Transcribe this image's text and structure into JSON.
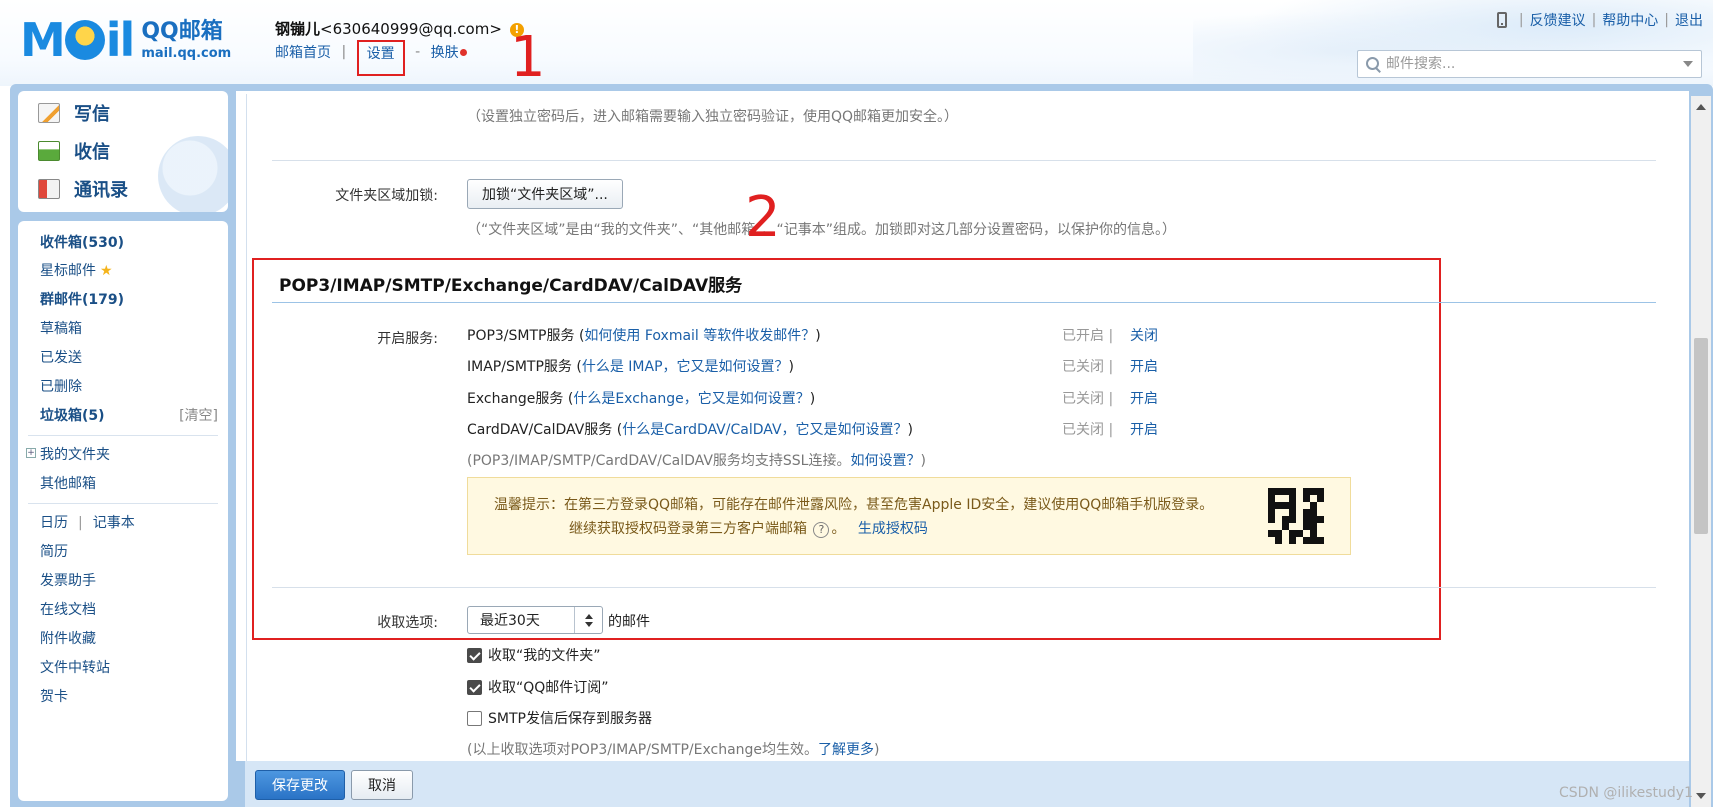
{
  "header": {
    "logo_brand": "QQ邮箱",
    "logo_url": "mail.qq.com",
    "user_name": "钢镚儿",
    "user_email": "<630640999@qq.com>",
    "nav": {
      "home": "邮箱首页",
      "settings": "设置",
      "dash": "-",
      "skin": "换肤"
    },
    "top_links": {
      "feedback": "反馈建议",
      "help": "帮助中心",
      "logout": "退出"
    },
    "search_placeholder": "邮件搜索..."
  },
  "annotations": {
    "one": "1",
    "two": "2"
  },
  "sidebar": {
    "compose": "写信",
    "receive": "收信",
    "contacts": "通讯录",
    "folders": {
      "inbox": "收件箱(530)",
      "starred": "星标邮件",
      "group": "群邮件(179)",
      "drafts": "草稿箱",
      "sent": "已发送",
      "deleted": "已删除",
      "spam": "垃圾箱(5)",
      "clear": "[清空]",
      "my_folders": "我的文件夹",
      "other_mailbox": "其他邮箱",
      "calendar": "日历",
      "calendar_sep": "|",
      "notes": "记事本",
      "resume": "简历",
      "invoice": "发票助手",
      "docs": "在线文档",
      "attachments": "附件收藏",
      "transfer": "文件中转站",
      "cards": "贺卡"
    }
  },
  "main": {
    "password_hint": "（设置独立密码后，进入邮箱需要输入独立密码验证，使用QQ邮箱更加安全。）",
    "folder_lock_label": "文件夹区域加锁:",
    "folder_lock_button": "加锁“文件夹区域”...",
    "folder_lock_hint": "（“文件夹区域”是由“我的文件夹”、“其他邮箱”、“记事本”组成。加锁即对这几部分设置密码，以保护你的信息。）",
    "section_title": "POP3/IMAP/SMTP/Exchange/CardDAV/CalDAV服务",
    "enable_label": "开启服务:",
    "services": [
      {
        "name": "POP3/SMTP服务 (",
        "link": "如何使用 Foxmail 等软件收发邮件？",
        "close": ")",
        "status": "已开启 |",
        "action": "关闭"
      },
      {
        "name": "IMAP/SMTP服务 (",
        "link": "什么是 IMAP，它又是如何设置？",
        "close": ")",
        "status": "已关闭 |",
        "action": "开启"
      },
      {
        "name": "Exchange服务 (",
        "link": "什么是Exchange，它又是如何设置？",
        "close": ")",
        "status": "已关闭 |",
        "action": "开启"
      },
      {
        "name": "CardDAV/CalDAV服务 (",
        "link": "什么是CardDAV/CalDAV，它又是如何设置？",
        "close": ")",
        "status": "已关闭 |",
        "action": "开启"
      }
    ],
    "ssl_hint": "(POP3/IMAP/SMTP/CardDAV/CalDAV服务均支持SSL连接。",
    "ssl_link": "如何设置？",
    "ssl_close": ")",
    "tip_line1": "温馨提示：在第三方登录QQ邮箱，可能存在邮件泄露风险，甚至危害Apple ID安全，建议使用QQ邮箱手机版登录。",
    "tip_line2": "继续获取授权码登录第三方客户端邮箱",
    "tip_help": "?",
    "tip_period": "。",
    "tip_link": "生成授权码",
    "receive_label": "收取选项:",
    "receive_select": "最近30天",
    "receive_suffix": "的邮件",
    "checkboxes": [
      {
        "label": "收取“我的文件夹”",
        "checked": true
      },
      {
        "label": "收取“QQ邮件订阅”",
        "checked": true
      },
      {
        "label": "SMTP发信后保存到服务器",
        "checked": false
      }
    ],
    "receive_hint": "(以上收取选项对POP3/IMAP/SMTP/Exchange均生效。",
    "receive_hint_link": "了解更多",
    "receive_hint_close": ")"
  },
  "footer": {
    "save": "保存更改",
    "cancel": "取消"
  },
  "watermark": "CSDN @ilikestudy1"
}
